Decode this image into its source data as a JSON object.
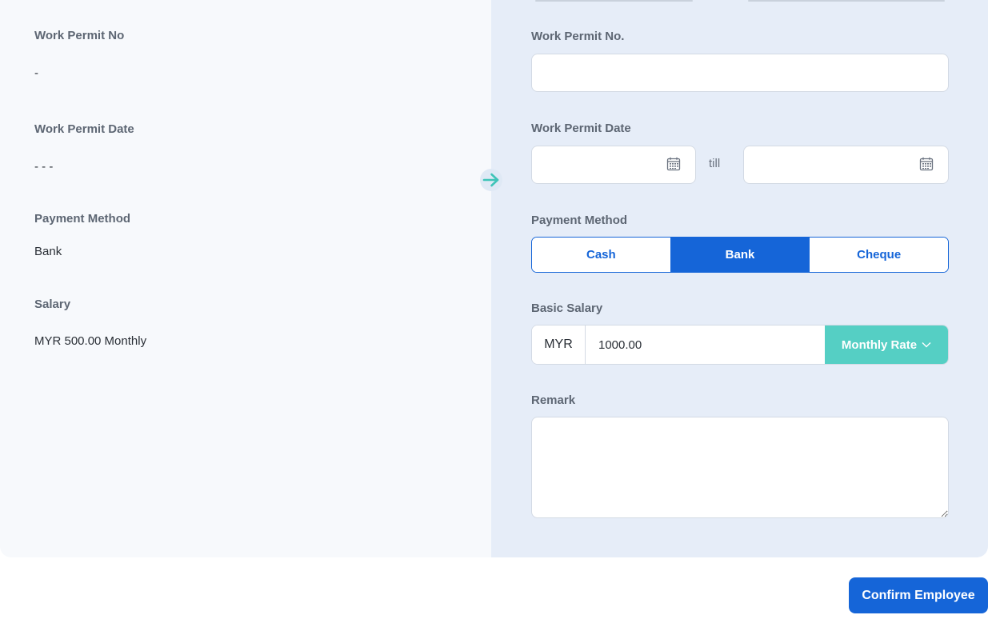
{
  "current": {
    "work_permit_no_label": "Work Permit No",
    "work_permit_no_value": "-",
    "work_permit_date_label": "Work Permit Date",
    "work_permit_date_value": "- - -",
    "payment_method_label": "Payment Method",
    "payment_method_value": "Bank",
    "salary_label": "Salary",
    "salary_value": "MYR 500.00 Monthly"
  },
  "edit": {
    "work_permit_no_label": "Work Permit No.",
    "work_permit_no_value": "",
    "work_permit_date_label": "Work Permit Date",
    "work_permit_date_from": "",
    "work_permit_date_till_label": "till",
    "work_permit_date_to": "",
    "payment_method_label": "Payment Method",
    "payment_options": [
      "Cash",
      "Bank",
      "Cheque"
    ],
    "payment_selected": "Bank",
    "basic_salary_label": "Basic Salary",
    "currency": "MYR",
    "basic_salary_value": "1000.00",
    "rate_label": "Monthly Rate",
    "remark_label": "Remark",
    "remark_value": ""
  },
  "icons": {
    "calendar": "calendar-icon",
    "arrow": "arrow-right-icon",
    "chevron": "chevron-down-icon"
  },
  "colors": {
    "primary": "#1565d8",
    "accent": "#55cfc4",
    "left_bg": "#f7f9fc",
    "right_bg": "#e6edf8"
  },
  "footer": {
    "confirm_label": "Confirm Employee"
  }
}
